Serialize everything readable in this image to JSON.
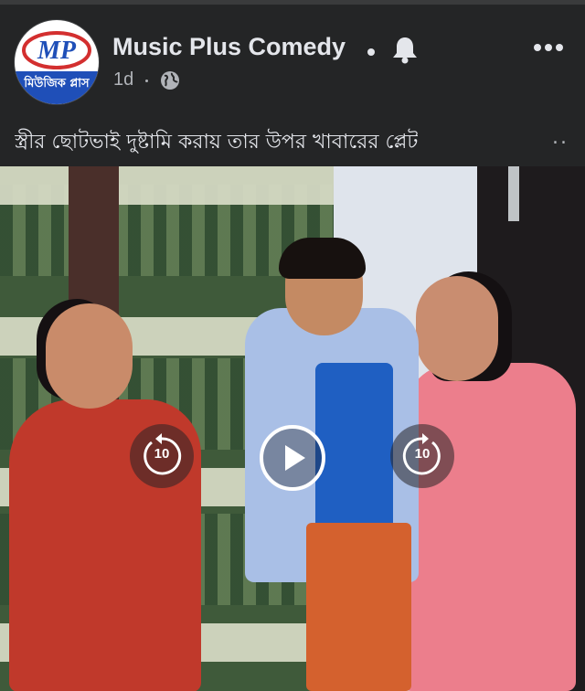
{
  "post": {
    "page_name": "Music Plus Comedy",
    "avatar_text": "মিউজিক প্লাস",
    "avatar_logo_text": "MP",
    "time": "1d",
    "privacy_icon": "globe-icon",
    "notification_icon": "bell-icon",
    "more_icon": "more-options-icon",
    "caption": "স্ত্রীর ছোটভাই দুষ্টামি করায় তার উপর খাবারের প্লেট",
    "caption_more": "..."
  },
  "video": {
    "rewind_label": "10",
    "forward_label": "10",
    "play_icon": "play-icon",
    "rewind_icon": "rewind-10-icon",
    "forward_icon": "forward-10-icon"
  },
  "colors": {
    "background": "#242526",
    "text_primary": "#e4e6eb",
    "text_secondary": "#b0b3b8",
    "avatar_blue": "#1f4fb8",
    "avatar_red": "#d32f2f"
  }
}
